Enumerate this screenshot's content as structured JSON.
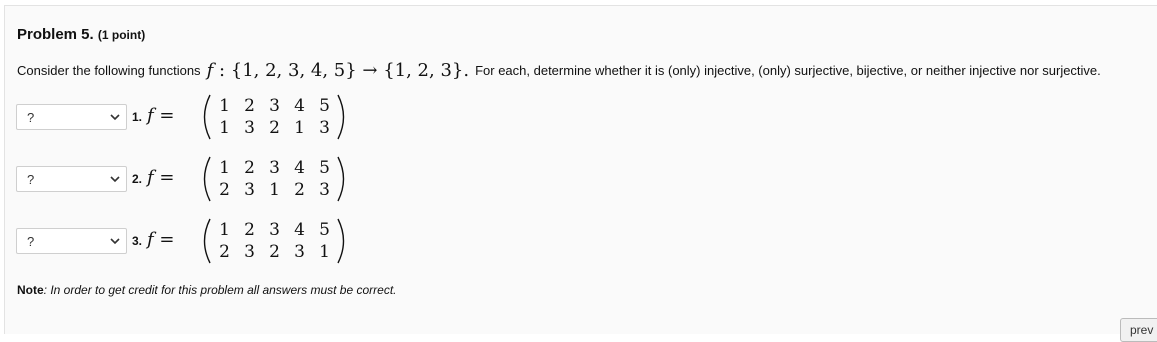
{
  "problem": {
    "title": "Problem 5.",
    "points": "(1 point)",
    "intro_before": "Consider the following functions",
    "math_f": "f",
    "math_mapping": " : {1, 2, 3, 4, 5} → {1, 2, 3}.",
    "intro_after": "For each, determine whether it is (only) injective, (only) surjective, bijective, or neither injective nor surjective."
  },
  "items": [
    {
      "label": "1.",
      "select_value": "?",
      "f": "f",
      "eq": " =",
      "top": [
        "1",
        "2",
        "3",
        "4",
        "5"
      ],
      "bottom": [
        "1",
        "3",
        "2",
        "1",
        "3"
      ]
    },
    {
      "label": "2.",
      "select_value": "?",
      "f": "f",
      "eq": " =",
      "top": [
        "1",
        "2",
        "3",
        "4",
        "5"
      ],
      "bottom": [
        "2",
        "3",
        "1",
        "2",
        "3"
      ]
    },
    {
      "label": "3.",
      "select_value": "?",
      "f": "f",
      "eq": " =",
      "top": [
        "1",
        "2",
        "3",
        "4",
        "5"
      ],
      "bottom": [
        "2",
        "3",
        "2",
        "3",
        "1"
      ]
    }
  ],
  "note": {
    "label": "Note",
    "text": ": In order to get credit for this problem all answers must be correct."
  },
  "nav": {
    "prev_label": "prev"
  },
  "icons": {
    "dropdown": "chevron-down-icon"
  }
}
